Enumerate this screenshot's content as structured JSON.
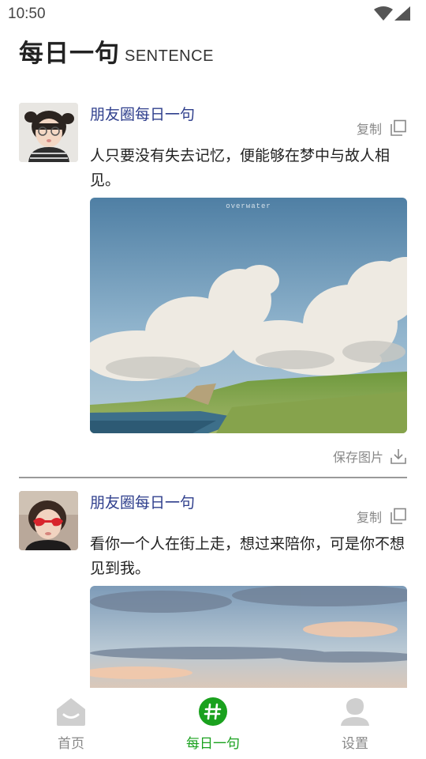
{
  "status_bar": {
    "time": "10:50"
  },
  "header": {
    "title": "每日一句",
    "subtitle": "SENTENCE"
  },
  "posts": [
    {
      "author": "朋友圈每日一句",
      "copy_label": "复制",
      "text": "人只要没有失去记忆，便能够在梦中与故人相见。",
      "image_watermark": "overwater",
      "save_label": "保存图片"
    },
    {
      "author": "朋友圈每日一句",
      "copy_label": "复制",
      "text": "看你一个人在街上走，想过来陪你，可是你不想见到我。"
    }
  ],
  "bottom_nav": {
    "items": [
      {
        "label": "首页",
        "icon": "home-icon"
      },
      {
        "label": "每日一句",
        "icon": "hashtag-icon"
      },
      {
        "label": "设置",
        "icon": "user-icon"
      }
    ],
    "active_index": 1,
    "active_color": "#1aa11e",
    "inactive_color": "#888888"
  },
  "colors": {
    "author": "#2e3e8c",
    "accent": "#1aa11e"
  }
}
